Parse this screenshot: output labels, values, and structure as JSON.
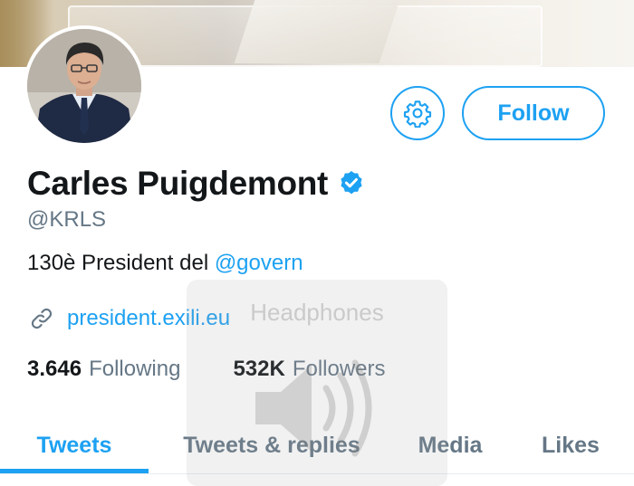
{
  "profile": {
    "name": "Carles Puigdemont",
    "handle": "@KRLS",
    "bio_text": "130è President del ",
    "bio_mention": "@govern",
    "url": "president.exili.eu",
    "verified": true
  },
  "actions": {
    "follow_label": "Follow",
    "settings_icon": "gear-icon"
  },
  "stats": {
    "following_count": "3.646",
    "following_label": "Following",
    "followers_count": "532K",
    "followers_label": "Followers"
  },
  "tabs": [
    {
      "label": "Tweets",
      "active": true
    },
    {
      "label": "Tweets & replies",
      "active": false
    },
    {
      "label": "Media",
      "active": false
    },
    {
      "label": "Likes",
      "active": false
    }
  ],
  "overlay": {
    "label": "Headphones",
    "icon": "speaker-icon"
  },
  "colors": {
    "accent": "#1da1f2",
    "text": "#14171a",
    "secondary": "#657786"
  }
}
